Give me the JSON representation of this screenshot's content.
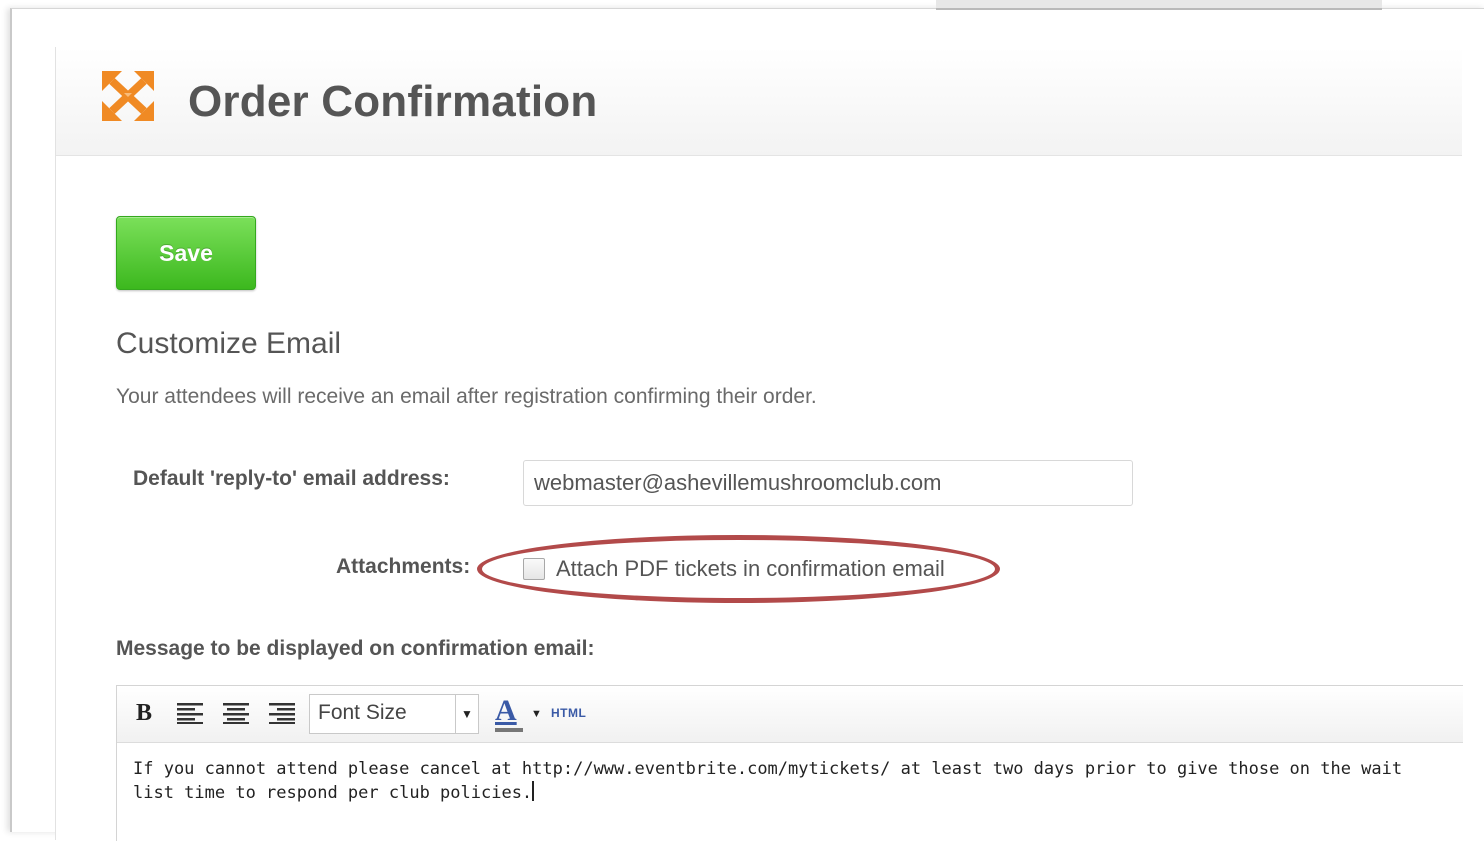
{
  "header": {
    "title": "Order Confirmation",
    "logo_icon": "eventbrite-arrows-icon",
    "logo_color": "#f08a24"
  },
  "actions": {
    "save_label": "Save",
    "save_color": "#4bbf2a"
  },
  "customize": {
    "title": "Customize Email",
    "description": "Your attendees will receive an email after registration confirming their order."
  },
  "reply_to": {
    "label": "Default 'reply-to' email address:",
    "value": "webmaster@ashevillemushroomclub.com"
  },
  "attachments": {
    "label": "Attachments:",
    "checkbox_label": "Attach PDF tickets in confirmation email",
    "checked": false,
    "highlight_color": "#b24a4a"
  },
  "message": {
    "label": "Message to be displayed on confirmation email:",
    "toolbar": {
      "bold": "B",
      "align_left_icon": "align-left-icon",
      "align_center_icon": "align-center-icon",
      "align_right_icon": "align-right-icon",
      "font_size": "Font Size",
      "text_color_glyph": "A",
      "html_label": "HTML"
    },
    "body": "If you cannot attend please cancel at http://www.eventbrite.com/mytickets/ at least two days prior to give those on the wait list time to respond per club policies."
  }
}
